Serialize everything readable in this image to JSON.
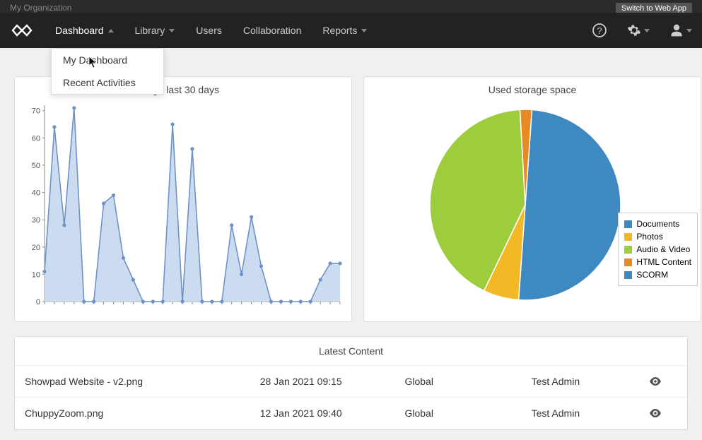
{
  "topbar": {
    "org_label": "My Organization",
    "switch_label": "Switch to Web App"
  },
  "nav": {
    "dashboard": "Dashboard",
    "library": "Library",
    "users": "Users",
    "collaboration": "Collaboration",
    "reports": "Reports"
  },
  "dropdown": {
    "item1": "My Dashboard",
    "item2": "Recent Activities"
  },
  "panel_usage": {
    "title_suffix": "age last 30 days"
  },
  "panel_storage": {
    "title": "Used storage space"
  },
  "chart_data": [
    {
      "type": "line",
      "title": "Usage last 30 days",
      "xlabel": "",
      "ylabel": "",
      "ylim": [
        0,
        72
      ],
      "yticks": [
        0,
        10,
        20,
        30,
        40,
        50,
        60,
        70
      ],
      "x": [
        1,
        2,
        3,
        4,
        5,
        6,
        7,
        8,
        9,
        10,
        11,
        12,
        13,
        14,
        15,
        16,
        17,
        18,
        19,
        20,
        21,
        22,
        23,
        24,
        25,
        26,
        27,
        28,
        29,
        30,
        31
      ],
      "values": [
        11,
        64,
        28,
        71,
        0,
        0,
        36,
        39,
        16,
        8,
        0,
        0,
        0,
        65,
        0,
        56,
        0,
        0,
        0,
        28,
        10,
        31,
        13,
        0,
        0,
        0,
        0,
        0,
        8,
        14,
        14
      ]
    },
    {
      "type": "pie",
      "title": "Used storage space",
      "series": [
        {
          "name": "Documents",
          "value": 50,
          "color": "#3E89BF"
        },
        {
          "name": "Photos",
          "value": 6,
          "color": "#F2B825"
        },
        {
          "name": "Audio & Video",
          "value": 42,
          "color": "#9DCC3D"
        },
        {
          "name": "HTML Content",
          "value": 2,
          "color": "#E88A24"
        },
        {
          "name": "SCORM",
          "value": 0,
          "color": "#3E89BF"
        }
      ]
    }
  ],
  "legend": {
    "documents": "Documents",
    "photos": "Photos",
    "audio_video": "Audio & Video",
    "html_content": "HTML Content",
    "scorm": "SCORM"
  },
  "colors": {
    "documents": "#3E89BF",
    "photos": "#F2B825",
    "audio_video": "#9DCC3D",
    "html_content": "#E88A24",
    "scorm": "#3E89BF",
    "line_stroke": "#6F92C7",
    "line_fill": "#CBDCF0"
  },
  "table": {
    "title": "Latest Content",
    "rows": [
      {
        "name": "Showpad Website - v2.png",
        "date": "28 Jan 2021 09:15",
        "scope": "Global",
        "owner": "Test Admin"
      },
      {
        "name": "ChuppyZoom.png",
        "date": "12 Jan 2021 09:40",
        "scope": "Global",
        "owner": "Test Admin"
      }
    ]
  }
}
